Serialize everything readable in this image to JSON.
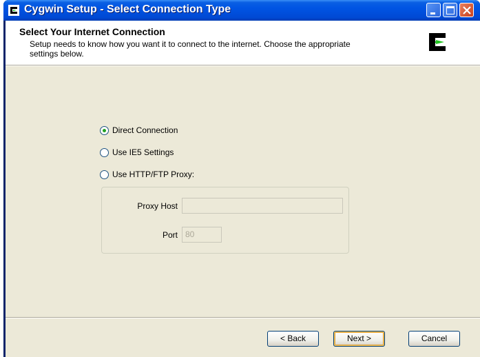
{
  "window": {
    "title": "Cygwin Setup - Select Connection Type",
    "icon": "cygwin-logo-icon",
    "controls": [
      "minimize-icon",
      "maximize-icon",
      "close-icon"
    ]
  },
  "header": {
    "title": "Select Your Internet Connection",
    "subtitle": "Setup needs to know how you want it to connect to the internet.  Choose the appropriate settings below.",
    "icon": "cygwin-logo-icon"
  },
  "options": {
    "direct": {
      "label": "Direct Connection",
      "selected": true
    },
    "ie5": {
      "label": "Use IE5 Settings",
      "selected": false
    },
    "proxy": {
      "label": "Use HTTP/FTP Proxy:",
      "selected": false
    }
  },
  "proxy": {
    "host_label": "Proxy Host",
    "host_value": "",
    "port_label": "Port",
    "port_value": "80"
  },
  "buttons": {
    "back": "< Back",
    "next": "Next >",
    "cancel": "Cancel"
  },
  "colors": {
    "titlebar": "#0054e3",
    "dialog_bg": "#ece9d8",
    "radio_dot": "#21a121",
    "logo_green": "#21c421"
  }
}
